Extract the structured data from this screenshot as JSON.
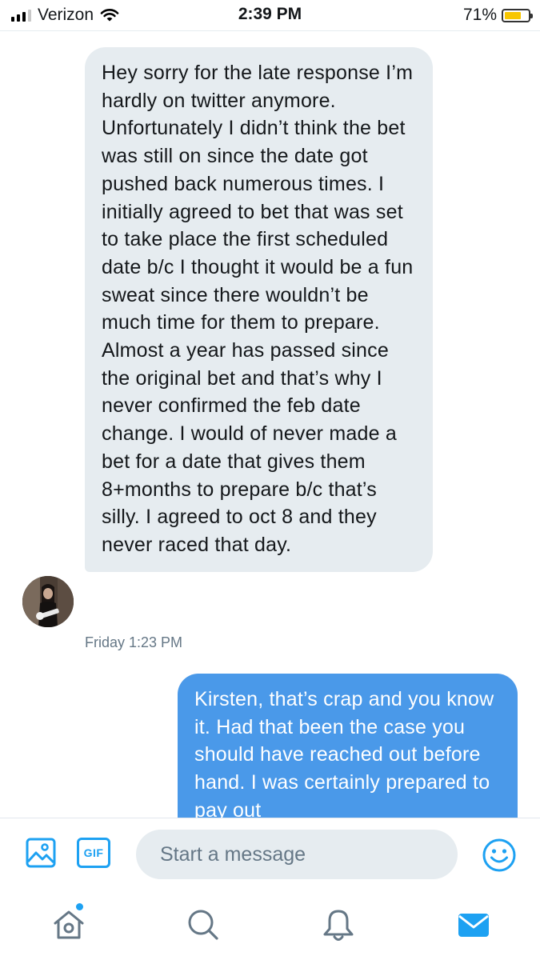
{
  "status_bar": {
    "carrier": "Verizon",
    "time": "2:39 PM",
    "battery_percent": "71%",
    "battery_level": 0.71,
    "battery_color": "#f7c600"
  },
  "conversation": {
    "received": {
      "text": "Hey sorry for the late response I’m hardly on twitter anymore. Unfortunately I didn’t think the bet was still on since the date got pushed back numerous times. I initially agreed to bet that was set to take place the first scheduled date b/c I thought it would be a fun sweat since there wouldn’t be much time for them to prepare. Almost a year has passed since the original bet and that’s why I never confirmed the feb date change. I would of never made a bet for a date that gives them 8+months to prepare b/c that’s silly. I agreed to oct 8 and they never raced that day.",
      "timestamp": "Friday 1:23 PM",
      "bubble_color": "#e6ecf0"
    },
    "sent": {
      "text": "Kirsten, that’s crap and you know it. Had that been the case you should have reached out before hand. I was certainly prepared to pay out",
      "bubble_color": "#4a99e9"
    }
  },
  "composer": {
    "placeholder": "Start a message",
    "gif_label": "GIF",
    "accent_color": "#1da1f2"
  },
  "tab_bar": {
    "items": [
      "home-icon",
      "search-icon",
      "notifications-icon",
      "messages-icon"
    ],
    "active": "messages-icon"
  }
}
